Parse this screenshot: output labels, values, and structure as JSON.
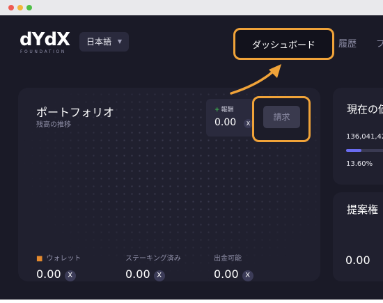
{
  "header": {
    "logo_text": "dYdX",
    "logo_subtext": "FOUNDATION",
    "language": "日本語",
    "nav": {
      "dashboard": "ダッシュボード",
      "history": "履歴",
      "more": "プ"
    }
  },
  "portfolio": {
    "title": "ポートフォリオ",
    "subtitle": "残高の推移",
    "reward": {
      "label": "報酬",
      "value": "0.00",
      "token": "X"
    },
    "claim_label": "請求",
    "stats": [
      {
        "label": "ウォレット",
        "value": "0.00",
        "token": "X"
      },
      {
        "label": "ステーキング済み",
        "value": "0.00",
        "token": "X"
      },
      {
        "label": "出金可能",
        "value": "0.00",
        "token": "X"
      }
    ]
  },
  "right_card_1": {
    "title": "現在の価",
    "number": "136,041,42",
    "percent": "13.60%",
    "progress_fraction": 0.136
  },
  "right_card_2": {
    "title": "提案権",
    "value": "0.00"
  },
  "colors": {
    "highlight": "#f0a339",
    "background": "#1a1a27",
    "card": "#20202f",
    "progress": "#6a6cf0"
  }
}
